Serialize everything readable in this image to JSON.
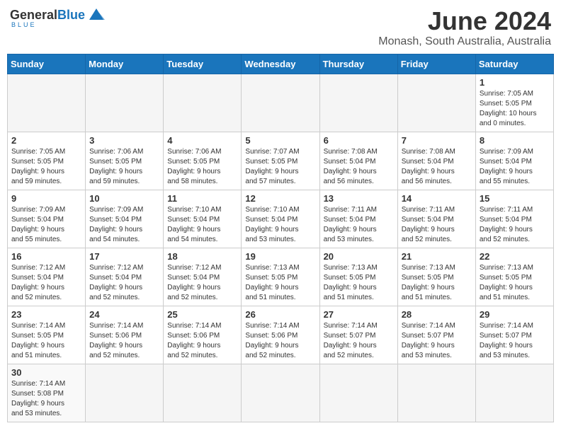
{
  "header": {
    "logo_general": "General",
    "logo_blue": "Blue",
    "logo_tagline": "BLUE",
    "month_title": "June 2024",
    "location": "Monash, South Australia, Australia"
  },
  "weekdays": [
    "Sunday",
    "Monday",
    "Tuesday",
    "Wednesday",
    "Thursday",
    "Friday",
    "Saturday"
  ],
  "weeks": [
    [
      {
        "day": "",
        "info": ""
      },
      {
        "day": "",
        "info": ""
      },
      {
        "day": "",
        "info": ""
      },
      {
        "day": "",
        "info": ""
      },
      {
        "day": "",
        "info": ""
      },
      {
        "day": "",
        "info": ""
      },
      {
        "day": "1",
        "info": "Sunrise: 7:05 AM\nSunset: 5:05 PM\nDaylight: 10 hours\nand 0 minutes."
      }
    ],
    [
      {
        "day": "2",
        "info": "Sunrise: 7:05 AM\nSunset: 5:05 PM\nDaylight: 9 hours\nand 59 minutes."
      },
      {
        "day": "3",
        "info": "Sunrise: 7:06 AM\nSunset: 5:05 PM\nDaylight: 9 hours\nand 59 minutes."
      },
      {
        "day": "4",
        "info": "Sunrise: 7:06 AM\nSunset: 5:05 PM\nDaylight: 9 hours\nand 58 minutes."
      },
      {
        "day": "5",
        "info": "Sunrise: 7:07 AM\nSunset: 5:05 PM\nDaylight: 9 hours\nand 57 minutes."
      },
      {
        "day": "6",
        "info": "Sunrise: 7:08 AM\nSunset: 5:04 PM\nDaylight: 9 hours\nand 56 minutes."
      },
      {
        "day": "7",
        "info": "Sunrise: 7:08 AM\nSunset: 5:04 PM\nDaylight: 9 hours\nand 56 minutes."
      },
      {
        "day": "8",
        "info": "Sunrise: 7:09 AM\nSunset: 5:04 PM\nDaylight: 9 hours\nand 55 minutes."
      }
    ],
    [
      {
        "day": "9",
        "info": "Sunrise: 7:09 AM\nSunset: 5:04 PM\nDaylight: 9 hours\nand 55 minutes."
      },
      {
        "day": "10",
        "info": "Sunrise: 7:09 AM\nSunset: 5:04 PM\nDaylight: 9 hours\nand 54 minutes."
      },
      {
        "day": "11",
        "info": "Sunrise: 7:10 AM\nSunset: 5:04 PM\nDaylight: 9 hours\nand 54 minutes."
      },
      {
        "day": "12",
        "info": "Sunrise: 7:10 AM\nSunset: 5:04 PM\nDaylight: 9 hours\nand 53 minutes."
      },
      {
        "day": "13",
        "info": "Sunrise: 7:11 AM\nSunset: 5:04 PM\nDaylight: 9 hours\nand 53 minutes."
      },
      {
        "day": "14",
        "info": "Sunrise: 7:11 AM\nSunset: 5:04 PM\nDaylight: 9 hours\nand 52 minutes."
      },
      {
        "day": "15",
        "info": "Sunrise: 7:11 AM\nSunset: 5:04 PM\nDaylight: 9 hours\nand 52 minutes."
      }
    ],
    [
      {
        "day": "16",
        "info": "Sunrise: 7:12 AM\nSunset: 5:04 PM\nDaylight: 9 hours\nand 52 minutes."
      },
      {
        "day": "17",
        "info": "Sunrise: 7:12 AM\nSunset: 5:04 PM\nDaylight: 9 hours\nand 52 minutes."
      },
      {
        "day": "18",
        "info": "Sunrise: 7:12 AM\nSunset: 5:04 PM\nDaylight: 9 hours\nand 52 minutes."
      },
      {
        "day": "19",
        "info": "Sunrise: 7:13 AM\nSunset: 5:05 PM\nDaylight: 9 hours\nand 51 minutes."
      },
      {
        "day": "20",
        "info": "Sunrise: 7:13 AM\nSunset: 5:05 PM\nDaylight: 9 hours\nand 51 minutes."
      },
      {
        "day": "21",
        "info": "Sunrise: 7:13 AM\nSunset: 5:05 PM\nDaylight: 9 hours\nand 51 minutes."
      },
      {
        "day": "22",
        "info": "Sunrise: 7:13 AM\nSunset: 5:05 PM\nDaylight: 9 hours\nand 51 minutes."
      }
    ],
    [
      {
        "day": "23",
        "info": "Sunrise: 7:14 AM\nSunset: 5:05 PM\nDaylight: 9 hours\nand 51 minutes."
      },
      {
        "day": "24",
        "info": "Sunrise: 7:14 AM\nSunset: 5:06 PM\nDaylight: 9 hours\nand 52 minutes."
      },
      {
        "day": "25",
        "info": "Sunrise: 7:14 AM\nSunset: 5:06 PM\nDaylight: 9 hours\nand 52 minutes."
      },
      {
        "day": "26",
        "info": "Sunrise: 7:14 AM\nSunset: 5:06 PM\nDaylight: 9 hours\nand 52 minutes."
      },
      {
        "day": "27",
        "info": "Sunrise: 7:14 AM\nSunset: 5:07 PM\nDaylight: 9 hours\nand 52 minutes."
      },
      {
        "day": "28",
        "info": "Sunrise: 7:14 AM\nSunset: 5:07 PM\nDaylight: 9 hours\nand 53 minutes."
      },
      {
        "day": "29",
        "info": "Sunrise: 7:14 AM\nSunset: 5:07 PM\nDaylight: 9 hours\nand 53 minutes."
      }
    ],
    [
      {
        "day": "30",
        "info": "Sunrise: 7:14 AM\nSunset: 5:08 PM\nDaylight: 9 hours\nand 53 minutes."
      },
      {
        "day": "",
        "info": ""
      },
      {
        "day": "",
        "info": ""
      },
      {
        "day": "",
        "info": ""
      },
      {
        "day": "",
        "info": ""
      },
      {
        "day": "",
        "info": ""
      },
      {
        "day": "",
        "info": ""
      }
    ]
  ]
}
